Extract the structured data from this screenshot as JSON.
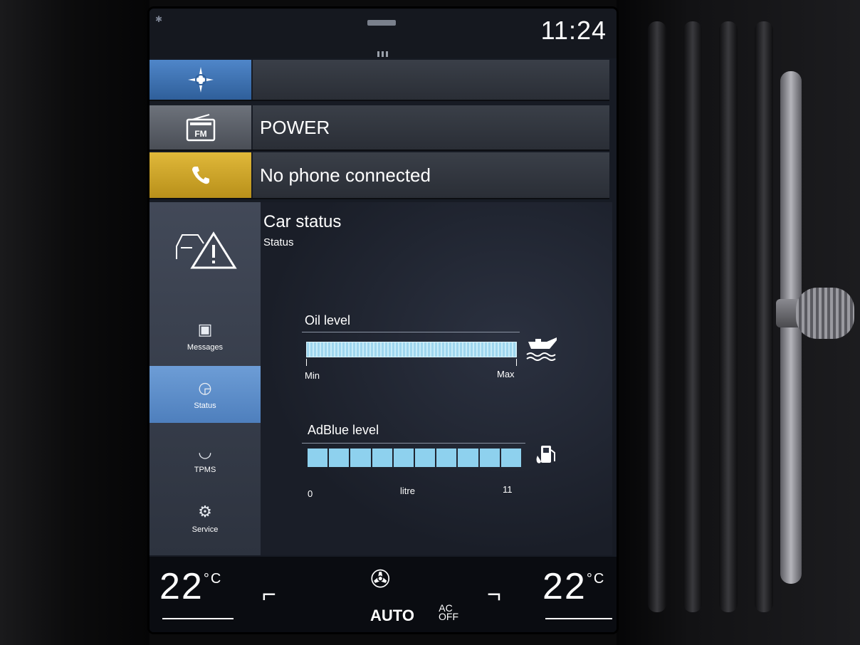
{
  "status_bar": {
    "time": "11:24"
  },
  "tiles": {
    "navigation": {
      "label": "",
      "icon": "compass-icon"
    },
    "radio": {
      "label": "POWER",
      "icon": "radio-fm-icon",
      "icon_text": "FM"
    },
    "phone": {
      "label": "No phone connected",
      "icon": "phone-icon"
    }
  },
  "car_status": {
    "title": "Car status",
    "subtitle": "Status",
    "sidebar": [
      {
        "label": "",
        "icon": "car-warning-icon"
      },
      {
        "label": "Messages",
        "icon": "messages-icon"
      },
      {
        "label": "Status",
        "icon": "status-gauge-icon",
        "active": true
      },
      {
        "label": "TPMS",
        "icon": "tire-pressure-icon"
      },
      {
        "label": "Service",
        "icon": "service-wrench-icon"
      }
    ],
    "oil": {
      "label": "Oil level",
      "min": "Min",
      "max": "Max",
      "fill_fraction": 1.0,
      "icon": "oil-can-icon"
    },
    "adblue": {
      "label": "AdBlue level",
      "min": "0",
      "unit": "litre",
      "max": "11",
      "segments_filled": 10,
      "segments_total": 10,
      "icon": "fuel-pump-icon"
    }
  },
  "climate": {
    "left_temp": "22",
    "right_temp": "22",
    "unit": "°C",
    "mode": "AUTO",
    "ac_label_top": "AC",
    "ac_label_bottom": "OFF"
  },
  "colors": {
    "nav_accent": "#4f86c9",
    "phone_accent": "#e0b83a",
    "active_item": "#6d9dd6",
    "gauge_fill": "#8ed1ee"
  }
}
